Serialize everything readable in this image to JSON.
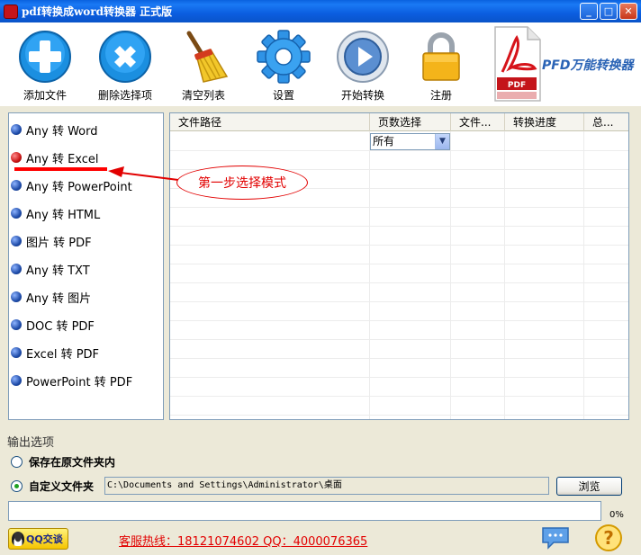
{
  "window": {
    "title": "pdf转换成word转换器 正式版",
    "min_symbol": "_",
    "max_symbol": "□",
    "close_symbol": "✕"
  },
  "toolbar": {
    "buttons": [
      {
        "label": "添加文件",
        "icon": "plus-icon"
      },
      {
        "label": "删除选择项",
        "icon": "delete-icon"
      },
      {
        "label": "清空列表",
        "icon": "broom-icon"
      },
      {
        "label": "设置",
        "icon": "gear-icon"
      },
      {
        "label": "开始转换",
        "icon": "play-icon"
      },
      {
        "label": "注册",
        "icon": "lock-icon"
      }
    ],
    "brand_text": "PFD万能转换器",
    "brand_badge": "PDF"
  },
  "modes": {
    "items": [
      {
        "label": "Any 转 Word",
        "active": false
      },
      {
        "label": "Any 转 Excel",
        "active": true
      },
      {
        "label": "Any 转 PowerPoint",
        "active": false
      },
      {
        "label": "Any 转 HTML",
        "active": false
      },
      {
        "label": "图片 转 PDF",
        "active": false
      },
      {
        "label": "Any 转 TXT",
        "active": false
      },
      {
        "label": "Any 转 图片",
        "active": false
      },
      {
        "label": "DOC 转 PDF",
        "active": false
      },
      {
        "label": "Excel 转 PDF",
        "active": false
      },
      {
        "label": "PowerPoint 转 PDF",
        "active": false
      }
    ]
  },
  "table": {
    "columns": [
      "文件路径",
      "页数选择",
      "文件...",
      "转换进度",
      "总..."
    ],
    "page_select_value": "所有"
  },
  "annotation": {
    "text": "第一步选择模式",
    "color": "#e20000"
  },
  "output": {
    "title": "输出选项",
    "option_same_folder": "保存在原文件夹内",
    "option_custom_folder": "自定义文件夹",
    "selected": "custom",
    "path_value": "C:\\Documents and Settings\\Administrator\\桌面",
    "browse_label": "浏览"
  },
  "progress": {
    "value": 0,
    "text": "0%"
  },
  "footer": {
    "qq_label": "QQ交谈",
    "hotline": "客服热线：18121074602 QQ：4000076365"
  }
}
